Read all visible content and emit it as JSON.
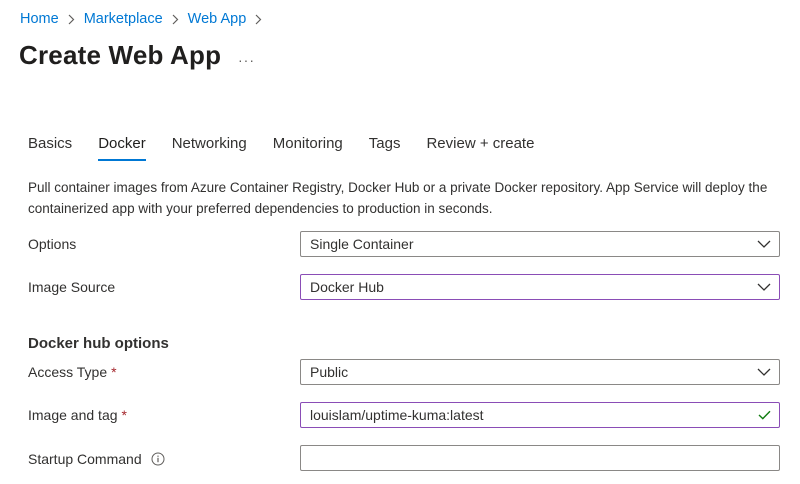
{
  "breadcrumb": {
    "items": [
      "Home",
      "Marketplace",
      "Web App"
    ]
  },
  "page": {
    "title": "Create Web App",
    "more_label": "···"
  },
  "tabs": [
    {
      "label": "Basics",
      "selected": false
    },
    {
      "label": "Docker",
      "selected": true
    },
    {
      "label": "Networking",
      "selected": false
    },
    {
      "label": "Monitoring",
      "selected": false
    },
    {
      "label": "Tags",
      "selected": false
    },
    {
      "label": "Review + create",
      "selected": false
    }
  ],
  "description": "Pull container images from Azure Container Registry, Docker Hub or a private Docker repository. App Service will deploy the containerized app with your preferred dependencies to production in seconds.",
  "form": {
    "options": {
      "label": "Options",
      "value": "Single Container"
    },
    "image_source": {
      "label": "Image Source",
      "value": "Docker Hub"
    },
    "section_heading": "Docker hub options",
    "access_type": {
      "label": "Access Type",
      "required_mark": "*",
      "value": "Public"
    },
    "image_tag": {
      "label": "Image and tag",
      "required_mark": "*",
      "value": "louislam/uptime-kuma:latest"
    },
    "startup_command": {
      "label": "Startup Command",
      "value": ""
    }
  },
  "icons": {
    "crumb_separator": "chevron-right-icon",
    "dropdown": "chevron-down-icon",
    "valid": "checkmark-icon",
    "info": "info-icon"
  },
  "colors": {
    "link": "#0078d4",
    "tab_underline": "#0078d4",
    "required": "#a4262c",
    "focus_border": "#8a4db6",
    "valid_check": "#107c10"
  }
}
